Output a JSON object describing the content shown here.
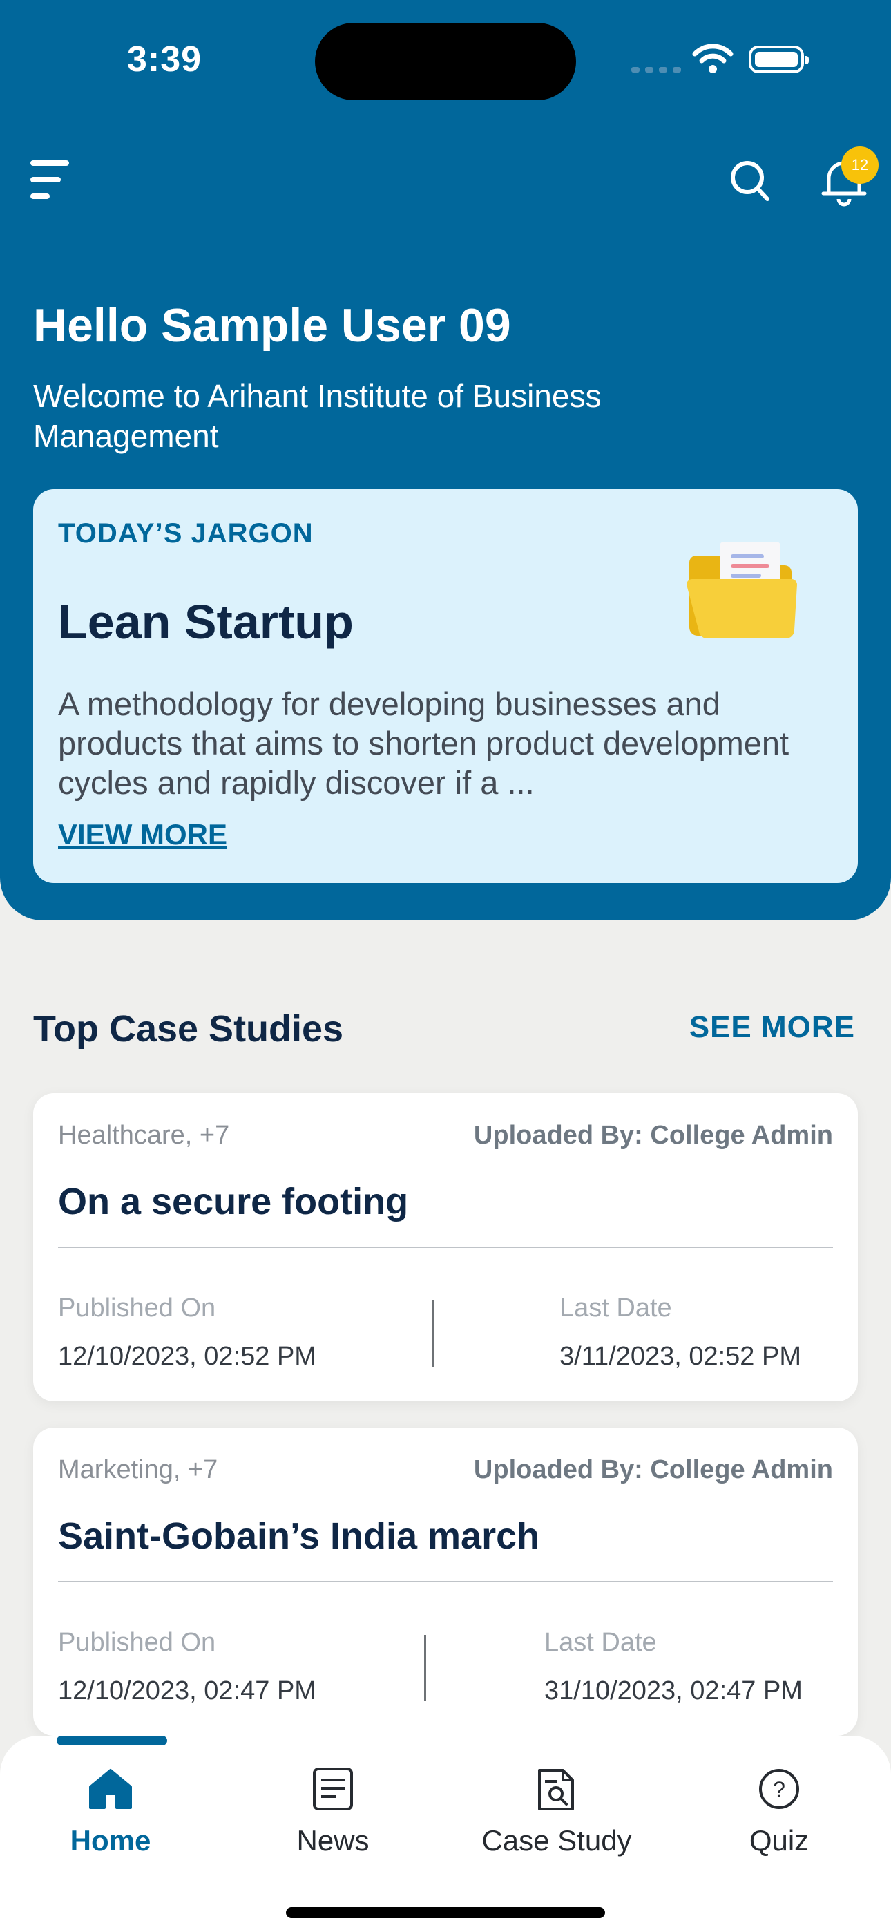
{
  "status_bar": {
    "time": "3:39"
  },
  "header": {
    "notification_count": "12",
    "greeting": "Hello Sample User 09",
    "welcome": "Welcome to Arihant Institute of Business Management"
  },
  "jargon": {
    "tag": "TODAY’S JARGON",
    "title": "Lean Startup",
    "description": "A methodology for developing businesses and products that aims to shorten product development cycles and rapidly discover if a ...",
    "view_more": "VIEW MORE"
  },
  "case_studies": {
    "title": "Top Case Studies",
    "see_more": "SEE MORE",
    "items": [
      {
        "category": "Healthcare, +7",
        "uploaded_by": "Uploaded By: College Admin",
        "title": "On a secure footing",
        "published_label": "Published On",
        "published_value": "12/10/2023, 02:52 PM",
        "last_label": "Last Date",
        "last_value": "3/11/2023, 02:52 PM"
      },
      {
        "category": "Marketing, +7",
        "uploaded_by": "Uploaded By: College Admin",
        "title": "Saint-Gobain’s India march",
        "published_label": "Published On",
        "published_value": "12/10/2023, 02:47 PM",
        "last_label": "Last Date",
        "last_value": "31/10/2023, 02:47 PM"
      }
    ]
  },
  "tabbar": {
    "tabs": [
      {
        "label": "Home",
        "icon": "home-icon",
        "active": true
      },
      {
        "label": "News",
        "icon": "news-icon",
        "active": false
      },
      {
        "label": "Case Study",
        "icon": "case-study-icon",
        "active": false
      },
      {
        "label": "Quiz",
        "icon": "quiz-icon",
        "active": false
      }
    ]
  },
  "colors": {
    "primary": "#01679b",
    "jargon_bg": "#dcf2fc",
    "badge": "#f8c20a",
    "title_text": "#0f2746",
    "page_bg": "#efefed"
  }
}
